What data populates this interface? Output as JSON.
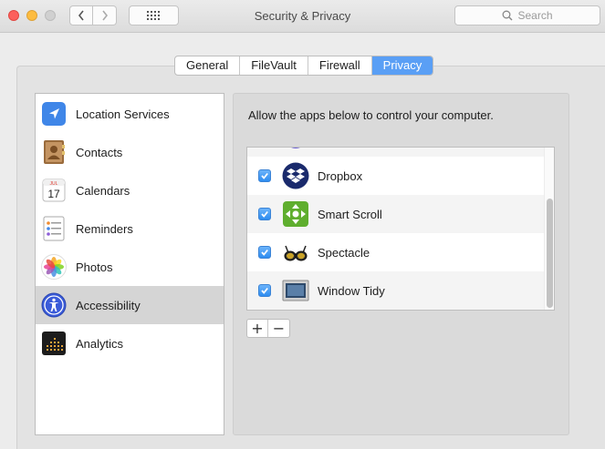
{
  "window": {
    "title": "Security & Privacy",
    "search_placeholder": "Search"
  },
  "tabs": [
    {
      "label": "General",
      "active": false
    },
    {
      "label": "FileVault",
      "active": false
    },
    {
      "label": "Firewall",
      "active": false
    },
    {
      "label": "Privacy",
      "active": true
    }
  ],
  "sidebar": {
    "items": [
      {
        "label": "Location Services",
        "icon": "location-arrow-icon",
        "selected": false
      },
      {
        "label": "Contacts",
        "icon": "contacts-book-icon",
        "selected": false
      },
      {
        "label": "Calendars",
        "icon": "calendar-icon",
        "selected": false
      },
      {
        "label": "Reminders",
        "icon": "reminders-list-icon",
        "selected": false
      },
      {
        "label": "Photos",
        "icon": "photos-flower-icon",
        "selected": false
      },
      {
        "label": "Accessibility",
        "icon": "accessibility-person-icon",
        "selected": true
      },
      {
        "label": "Analytics",
        "icon": "analytics-grid-icon",
        "selected": false
      }
    ]
  },
  "calendar_icon": {
    "month": "JUL",
    "day": "17"
  },
  "privacy": {
    "instruction": "Allow the apps below to control your computer.",
    "apps": [
      {
        "label": "Dropbox",
        "checked": true,
        "icon": "dropbox-icon"
      },
      {
        "label": "Smart Scroll",
        "checked": true,
        "icon": "smart-scroll-icon"
      },
      {
        "label": "Spectacle",
        "checked": true,
        "icon": "spectacle-glasses-icon"
      },
      {
        "label": "Window Tidy",
        "checked": true,
        "icon": "window-tidy-icon"
      }
    ],
    "add_label": "+",
    "remove_label": "−"
  },
  "colors": {
    "accent": "#5a9ff5",
    "selection": "#d5d5d5"
  }
}
